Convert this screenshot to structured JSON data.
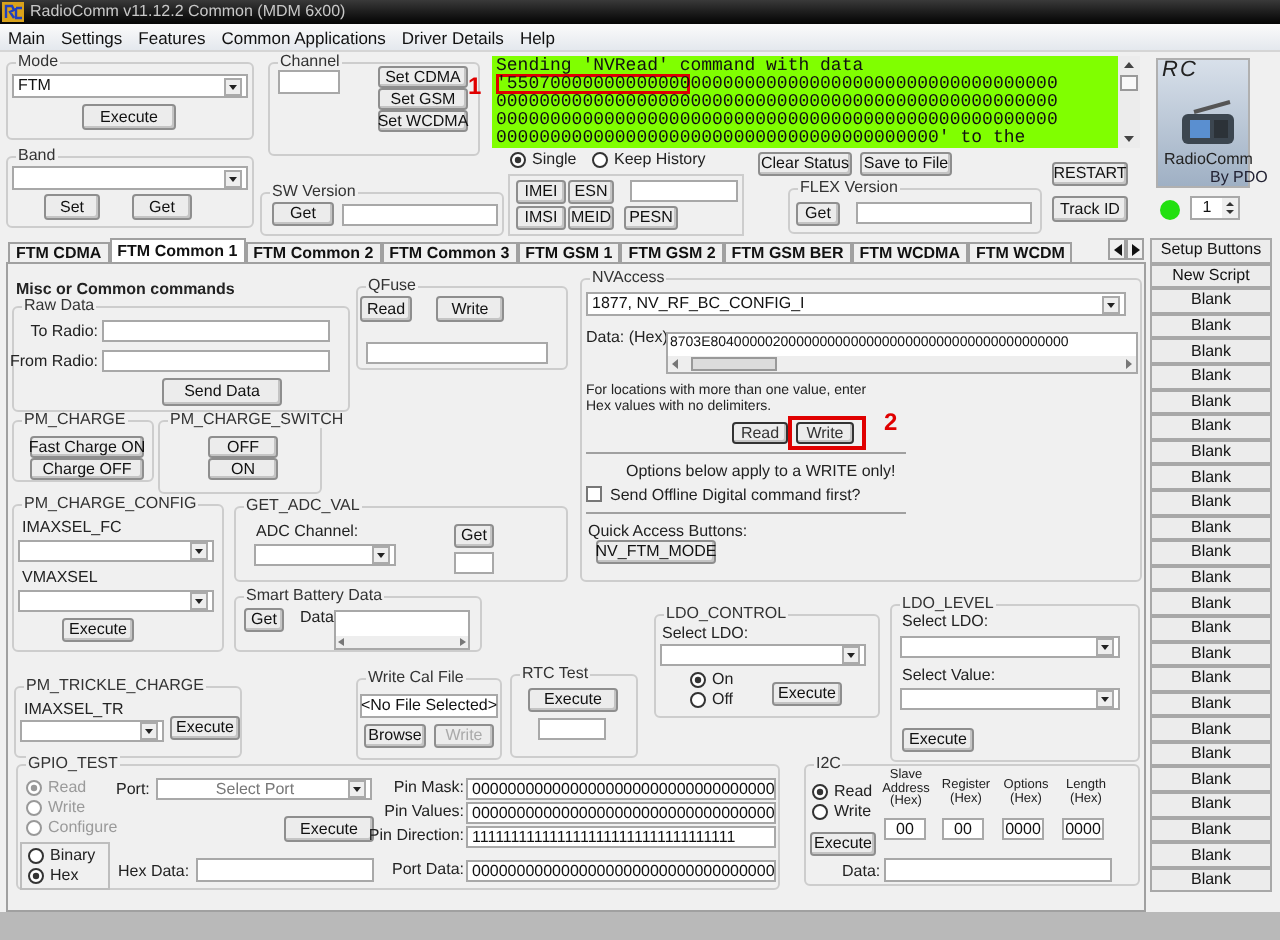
{
  "window": {
    "title": "RadioComm v11.12.2  Common (MDM 6x00)"
  },
  "menu": [
    "Main",
    "Settings",
    "Features",
    "Common Applications",
    "Driver Details",
    "Help"
  ],
  "mode": {
    "label": "Mode",
    "value": "FTM",
    "button": "Execute"
  },
  "band": {
    "label": "Band",
    "buttons": [
      "Set",
      "Get"
    ]
  },
  "channel": {
    "label": "Channel",
    "buttons": [
      "Set CDMA",
      "Set GSM",
      "Set WCDMA"
    ]
  },
  "sw_version": {
    "label": "SW Version",
    "button": "Get"
  },
  "status_log": {
    "callout": "1",
    "lines": [
      {
        "text": "Sending 'NVRead' command with data"
      },
      {
        "highlighted": "'55070000000000000",
        "text": "0000000000000000000000000000000000"
      },
      {
        "text": "0000000000000000000000000000000000000000000000000000"
      },
      {
        "text": "0000000000000000000000000000000000000000000000000000"
      },
      {
        "text": "00000000000000000000000000000000000000000' to the"
      }
    ]
  },
  "history_mode": [
    {
      "label": "Single",
      "selected": true
    },
    {
      "label": "Keep History",
      "selected": false
    }
  ],
  "id_buttons": [
    "IMEI",
    "ESN",
    "IMSI",
    "MEID",
    "PESN"
  ],
  "status_buttons": [
    "Clear Status",
    "Save to File"
  ],
  "flex_version": {
    "label": "FLEX Version",
    "button": "Get"
  },
  "side_buttons": [
    "RESTART",
    "Track ID"
  ],
  "logo": {
    "initials": "RC",
    "name": "RadioComm",
    "byline": "By PDO"
  },
  "connection": {
    "connected": true,
    "count": "1"
  },
  "tabs": [
    {
      "label": "FTM CDMA",
      "selected": false
    },
    {
      "label": "FTM Common 1",
      "selected": true
    },
    {
      "label": "FTM Common 2",
      "selected": false
    },
    {
      "label": "FTM Common 3",
      "selected": false
    },
    {
      "label": "FTM GSM 1",
      "selected": false
    },
    {
      "label": "FTM GSM 2",
      "selected": false
    },
    {
      "label": "FTM GSM BER",
      "selected": false
    },
    {
      "label": "FTM WCDMA",
      "selected": false
    },
    {
      "label": "FTM WCDM",
      "selected": false
    }
  ],
  "script_buttons": [
    "Setup Buttons",
    "New Script",
    "Blank",
    "Blank",
    "Blank",
    "Blank",
    "Blank",
    "Blank",
    "Blank",
    "Blank",
    "Blank",
    "Blank",
    "Blank",
    "Blank",
    "Blank",
    "Blank",
    "Blank",
    "Blank",
    "Blank",
    "Blank",
    "Blank",
    "Blank",
    "Blank",
    "Blank",
    "Blank",
    "Blank"
  ],
  "panel": {
    "heading": "Misc or Common commands",
    "raw_data": {
      "label": "Raw Data",
      "to_radio": "To Radio:",
      "from_radio": "From Radio:",
      "button": "Send Data"
    },
    "qfuse": {
      "label": "QFuse",
      "buttons": [
        "Read",
        "Write"
      ]
    },
    "pm_charge": {
      "label": "PM_CHARGE",
      "buttons": [
        "Fast Charge ON",
        "Charge OFF"
      ]
    },
    "pm_charge_switch": {
      "label": "PM_CHARGE_SWITCH",
      "buttons": [
        "OFF",
        "ON"
      ]
    },
    "pm_charge_config": {
      "label": "PM_CHARGE_CONFIG",
      "fields": [
        "IMAXSEL_FC",
        "VMAXSEL"
      ],
      "button": "Execute"
    },
    "get_adc_val": {
      "label": "GET_ADC_VAL",
      "field": "ADC Channel:",
      "button": "Get"
    },
    "smart_battery": {
      "label": "Smart Battery Data",
      "button": "Get",
      "data_label": "Data:"
    },
    "nv_access": {
      "label": "NVAccess",
      "item": "1877,  NV_RF_BC_CONFIG_I",
      "data_label": "Data: (Hex)",
      "data": "8703E8040000020000000000000000000000000000000000000",
      "hint": "For locations with more than one value, enter Hex values with no delimiters.",
      "buttons": [
        "Read",
        "Write"
      ],
      "callout": "2",
      "options_note": "Options below apply to a WRITE only!",
      "offline": {
        "label": "Send Offline Digital command first?",
        "checked": false
      },
      "quick_label": "Quick Access Buttons:",
      "quick_button": "NV_FTM_MODE"
    },
    "ldo_control": {
      "label": "LDO_CONTROL",
      "field": "Select LDO:",
      "options": [
        {
          "label": "On",
          "selected": true
        },
        {
          "label": "Off",
          "selected": false
        }
      ],
      "button": "Execute"
    },
    "ldo_level": {
      "label": "LDO_LEVEL",
      "fields": [
        "Select LDO:",
        "Select Value:"
      ],
      "button": "Execute"
    },
    "pm_trickle_charge": {
      "label": "PM_TRICKLE_CHARGE",
      "field": "IMAXSEL_TR",
      "button": "Execute"
    },
    "write_cal_file": {
      "label": "Write Cal File",
      "file": "<No File Selected>",
      "buttons": [
        {
          "label": "Browse",
          "disabled": false
        },
        {
          "label": "Write",
          "disabled": true
        }
      ]
    },
    "rtc_test": {
      "label": "RTC Test",
      "button": "Execute"
    },
    "gpio_test": {
      "label": "GPIO_TEST",
      "modes": [
        {
          "label": "Read",
          "selected": true,
          "disabled": true
        },
        {
          "label": "Write",
          "selected": false,
          "disabled": true
        },
        {
          "label": "Configure",
          "selected": false,
          "disabled": true
        }
      ],
      "formats": [
        {
          "label": "Binary",
          "selected": false
        },
        {
          "label": "Hex",
          "selected": true
        }
      ],
      "port_label": "Port:",
      "port": "Select Port",
      "button": "Execute",
      "hex_label": "Hex Data:",
      "pins": [
        {
          "label": "Pin Mask:",
          "value": "0000000000000000000000000000000000"
        },
        {
          "label": "Pin Values:",
          "value": "0000000000000000000000000000000000"
        },
        {
          "label": "Pin Direction:",
          "value": "1111111111111111111111111111111111"
        },
        {
          "label": "Port Data:",
          "value": "0000000000000000000000000000000000"
        }
      ]
    },
    "i2c": {
      "label": "I2C",
      "modes": [
        {
          "label": "Read",
          "selected": true
        },
        {
          "label": "Write",
          "selected": false
        }
      ],
      "columns": [
        {
          "header": "Slave Address (Hex)",
          "value": "00"
        },
        {
          "header": "Register (Hex)",
          "value": "00"
        },
        {
          "header": "Options (Hex)",
          "value": "0000"
        },
        {
          "header": "Length (Hex)",
          "value": "0000"
        }
      ],
      "button": "Execute",
      "data_label": "Data:"
    }
  }
}
